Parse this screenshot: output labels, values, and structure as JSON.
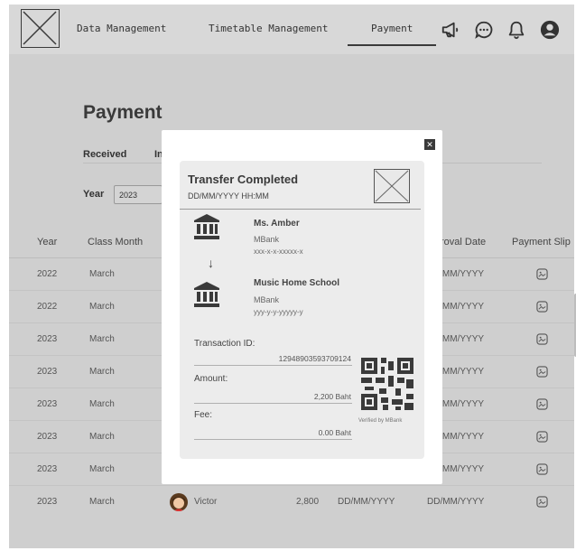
{
  "nav": {
    "links": [
      "Data Management",
      "Timetable Management",
      "Payment"
    ],
    "active": "Payment",
    "icons": [
      "megaphone-icon",
      "chat-icon",
      "bell-icon",
      "user-icon"
    ]
  },
  "page": {
    "title": "Payment",
    "tabs": [
      "Received",
      "In"
    ],
    "year_label": "Year",
    "year_value": "2023"
  },
  "table": {
    "headers": [
      "Year",
      "Class Month",
      "roval Date",
      "Payment Slip"
    ],
    "rows": [
      {
        "year": "2022",
        "month": "March",
        "approval": "'MM/YYYY"
      },
      {
        "year": "2022",
        "month": "March",
        "approval": "'MM/YYYY"
      },
      {
        "year": "2023",
        "month": "March",
        "approval": "'MM/YYYY"
      },
      {
        "year": "2023",
        "month": "March",
        "approval": "'MM/YYYY"
      },
      {
        "year": "2023",
        "month": "March",
        "approval": "'MM/YYYY"
      },
      {
        "year": "2023",
        "month": "March",
        "approval": "'MM/YYYY"
      },
      {
        "year": "2023",
        "month": "March",
        "approval": "'MM/YYYY"
      }
    ],
    "last_row": {
      "year": "2023",
      "month": "March",
      "student": "Victor",
      "amount": "2,800",
      "payment_date": "DD/MM/YYYY",
      "approval": "DD/MM/YYYY"
    }
  },
  "modal": {
    "close_label": "✕",
    "title": "Transfer Completed",
    "datetime": "DD/MM/YYYY HH:MM",
    "sender": {
      "name": "Ms. Amber",
      "bank": "MBank",
      "account": "xxx-x-x-xxxxx-x"
    },
    "arrow": "↓",
    "receiver": {
      "name": "Music Home School",
      "bank": "MBank",
      "account": "yyy-y-y-yyyyy-y"
    },
    "transaction_label": "Transaction ID:",
    "transaction_id": "12948903593709124",
    "amount_label": "Amount:",
    "amount": "2,200 Baht",
    "fee_label": "Fee:",
    "fee": "0.00 Baht",
    "verified": "Verified by MBank"
  }
}
